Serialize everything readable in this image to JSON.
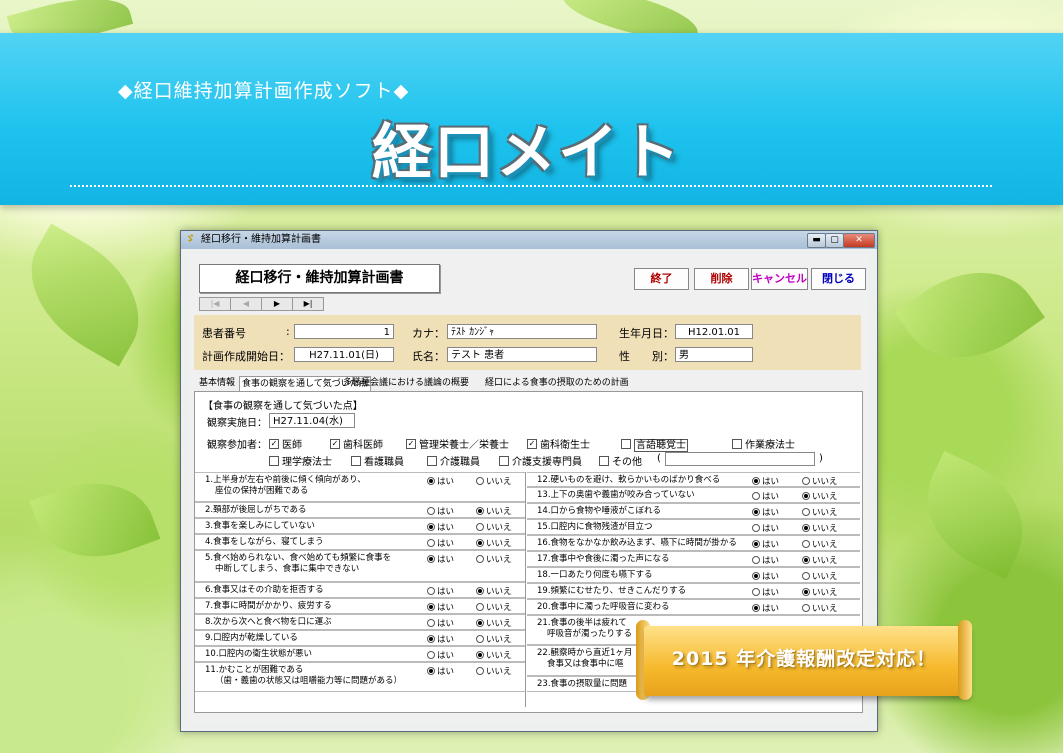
{
  "banner": {
    "subtitle": "◆経口維持加算計画作成ソフト◆",
    "logo": "経口メイト"
  },
  "window": {
    "title": "経口移行・維持加算計画書",
    "controls": {
      "minimize": "▬",
      "maximize": "▢",
      "close": "✕"
    }
  },
  "form": {
    "title": "経口移行・維持加算計画書",
    "buttons": {
      "end": "終了",
      "delete": "削除",
      "cancel": "キャンセル",
      "close": "閉じる"
    },
    "nav": [
      "|◀",
      "◀",
      "▶",
      "▶|"
    ]
  },
  "patient": {
    "id_label": "患者番号",
    "id_colon": ":",
    "id_value": "1",
    "kana_label": "カナ：",
    "kana_value": "ﾃｽﾄ ｶﾝｼﾞｬ",
    "dob_label": "生年月日：",
    "dob_value": "H12.01.01",
    "start_label": "計画作成開始日：",
    "start_value": "H27.11.01(日)",
    "name_label": "氏名：",
    "name_value": "テスト 患者",
    "sex_label": "性　　別：",
    "sex_value": "男"
  },
  "tabs": [
    "基本情報",
    "食事の観察を通して気づいた点",
    "多職種会議における議論の概要",
    "経口による食事の摂取のための計画"
  ],
  "observation": {
    "heading": "【食事の観察を通して気づいた点】",
    "date_label": "観察実施日：",
    "date_value": "H27.11.04(水)",
    "participants_label": "観察参加者：",
    "participants": [
      {
        "label": "医師",
        "checked": true
      },
      {
        "label": "歯科医師",
        "checked": true
      },
      {
        "label": "管理栄養士／栄養士",
        "checked": true
      },
      {
        "label": "歯科衛生士",
        "checked": true
      },
      {
        "label": "言語聴覚士",
        "checked": false
      },
      {
        "label": "作業療法士",
        "checked": false
      },
      {
        "label": "理学療法士",
        "checked": false
      },
      {
        "label": "看護職員",
        "checked": false
      },
      {
        "label": "介護職員",
        "checked": false
      },
      {
        "label": "介護支援専門員",
        "checked": false
      },
      {
        "label": "その他",
        "checked": false
      }
    ],
    "other_open": "(",
    "other_close": ")"
  },
  "answers": {
    "yes": "はい",
    "no": "いいえ"
  },
  "left_questions": [
    {
      "text": "1.上半身が左右や前後に傾く傾向があり、",
      "text2": "座位の保持が困難である",
      "answer": "yes"
    },
    {
      "text": "2.頚部が後屈しがちである",
      "text2": "",
      "answer": "no"
    },
    {
      "text": "3.食事を楽しみにしていない",
      "text2": "",
      "answer": "yes"
    },
    {
      "text": "4.食事をしながら、寝てしまう",
      "text2": "",
      "answer": "no"
    },
    {
      "text": "5.食べ始められない、食べ始めても頻繁に食事を",
      "text2": "中断してしまう、食事に集中できない",
      "answer": "yes"
    },
    {
      "text": "6.食事又はその介助を拒否する",
      "text2": "",
      "answer": "no"
    },
    {
      "text": "7.食事に時間がかかり、疲労する",
      "text2": "",
      "answer": "yes"
    },
    {
      "text": "8.次から次へと食べ物を口に運ぶ",
      "text2": "",
      "answer": "no"
    },
    {
      "text": "9.口腔内が乾燥している",
      "text2": "",
      "answer": "yes"
    },
    {
      "text": "10.口腔内の衛生状態が悪い",
      "text2": "",
      "answer": "no"
    },
    {
      "text": "11.かむことが困難である",
      "text2": "（歯・義歯の状態又は咀嚼能力等に問題がある）",
      "answer": "yes"
    }
  ],
  "right_questions": [
    {
      "text": "12.硬いものを避け、軟らかいものばかり食べる",
      "text2": "",
      "answer": "yes"
    },
    {
      "text": "13.上下の奥歯や義歯が咬み合っていない",
      "text2": "",
      "answer": "no"
    },
    {
      "text": "14.口から食物や唾液がこぼれる",
      "text2": "",
      "answer": "yes"
    },
    {
      "text": "15.口腔内に食物残渣が目立つ",
      "text2": "",
      "answer": "no"
    },
    {
      "text": "16.食物をなかなか飲み込まず、嚥下に時間が掛かる",
      "text2": "",
      "answer": "yes"
    },
    {
      "text": "17.食事中や食後に濁った声になる",
      "text2": "",
      "answer": "no"
    },
    {
      "text": "18.一口あたり何度も嚥下する",
      "text2": "",
      "answer": "yes"
    },
    {
      "text": "19.頻繁にむせたり、せきこんだりする",
      "text2": "",
      "answer": "no"
    },
    {
      "text": "20.食事中に濁った呼吸音に変わる",
      "text2": "",
      "answer": "yes"
    },
    {
      "text": "21.食事の後半は疲れて",
      "text2": "呼吸音が濁ったりする",
      "answer": ""
    },
    {
      "text": "22.観察時から直近1ヶ月",
      "text2": "食事又は食事中に嘔",
      "answer": ""
    },
    {
      "text": "23.食事の摂取量に問題",
      "text2": "",
      "answer": ""
    }
  ],
  "promo": {
    "text": "2015 年介護報酬改定対応！"
  }
}
